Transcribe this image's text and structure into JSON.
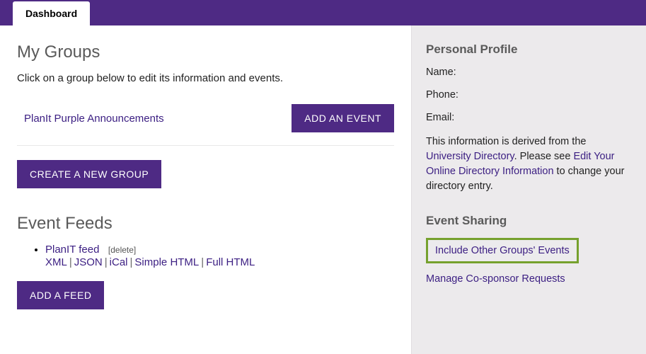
{
  "topbar": {
    "tab": "Dashboard"
  },
  "main": {
    "groups_title": "My Groups",
    "groups_subtext": "Click on a group below to edit its information and events.",
    "group_link": "PlanIt Purple Announcements",
    "add_event_btn": "ADD AN EVENT",
    "create_group_btn": "CREATE A NEW GROUP",
    "feeds_title": "Event Feeds",
    "feed": {
      "name": "PlanIT feed",
      "delete": "[delete]",
      "formats": {
        "xml": "XML",
        "json": "JSON",
        "ical": "iCal",
        "simple_html": "Simple HTML",
        "full_html": "Full HTML"
      }
    },
    "add_feed_btn": "ADD A FEED"
  },
  "sidebar": {
    "profile_title": "Personal Profile",
    "name_label": "Name:",
    "phone_label": "Phone:",
    "email_label": "Email:",
    "desc_pre": "This information is derived from the ",
    "desc_link1": "University Directory",
    "desc_mid": ". Please see ",
    "desc_link2": "Edit Your Online Directory Information",
    "desc_post": " to change your directory entry.",
    "sharing_title": "Event Sharing",
    "include_link": "Include Other Groups' Events",
    "manage_link": "Manage Co-sponsor Requests"
  }
}
